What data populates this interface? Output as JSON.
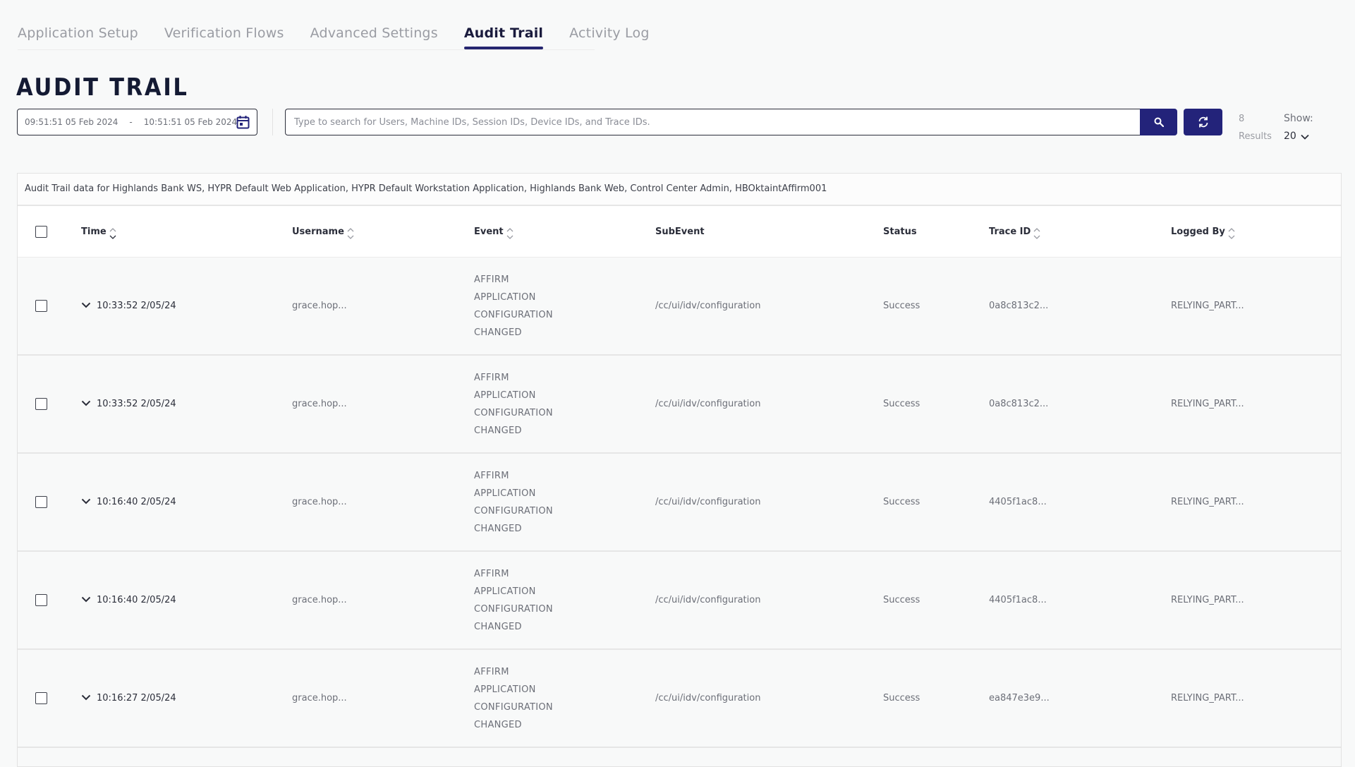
{
  "tabs": [
    {
      "label": "Application Setup",
      "active": false
    },
    {
      "label": "Verification Flows",
      "active": false
    },
    {
      "label": "Advanced Settings",
      "active": false
    },
    {
      "label": "Audit Trail",
      "active": true
    },
    {
      "label": "Activity Log",
      "active": false
    }
  ],
  "page": {
    "title": "AUDIT TRAIL"
  },
  "filters": {
    "date_start": "09:51:51 05 Feb 2024",
    "date_separator": "-",
    "date_end": "10:51:51 05 Feb 2024",
    "search_placeholder": "Type to search for Users, Machine IDs, Session IDs, Device IDs, and Trace IDs.",
    "search_value": ""
  },
  "results": {
    "count": "8",
    "label": "Results"
  },
  "show": {
    "label": "Show:",
    "value": "20"
  },
  "table": {
    "caption": "Audit Trail data for Highlands Bank WS, HYPR Default Web Application, HYPR Default Workstation Application, Highlands Bank Web, Control Center Admin, HBOktaintAffirm001",
    "columns": {
      "time": "Time",
      "username": "Username",
      "event": "Event",
      "subevent": "SubEvent",
      "status": "Status",
      "trace_id": "Trace ID",
      "logged_by": "Logged By"
    },
    "rows": [
      {
        "time": "10:33:52 2/05/24",
        "username": "grace.hop...",
        "event": [
          "AFFIRM",
          "APPLICATION",
          "CONFIGURATION",
          "CHANGED"
        ],
        "subevent": "/cc/ui/idv/configuration",
        "status": "Success",
        "trace_id": "0a8c813c2...",
        "logged_by": "RELYING_PART..."
      },
      {
        "time": "10:33:52 2/05/24",
        "username": "grace.hop...",
        "event": [
          "AFFIRM",
          "APPLICATION",
          "CONFIGURATION",
          "CHANGED"
        ],
        "subevent": "/cc/ui/idv/configuration",
        "status": "Success",
        "trace_id": "0a8c813c2...",
        "logged_by": "RELYING_PART..."
      },
      {
        "time": "10:16:40 2/05/24",
        "username": "grace.hop...",
        "event": [
          "AFFIRM",
          "APPLICATION",
          "CONFIGURATION",
          "CHANGED"
        ],
        "subevent": "/cc/ui/idv/configuration",
        "status": "Success",
        "trace_id": "4405f1ac8...",
        "logged_by": "RELYING_PART..."
      },
      {
        "time": "10:16:40 2/05/24",
        "username": "grace.hop...",
        "event": [
          "AFFIRM",
          "APPLICATION",
          "CONFIGURATION",
          "CHANGED"
        ],
        "subevent": "/cc/ui/idv/configuration",
        "status": "Success",
        "trace_id": "4405f1ac8...",
        "logged_by": "RELYING_PART..."
      },
      {
        "time": "10:16:27 2/05/24",
        "username": "grace.hop...",
        "event": [
          "AFFIRM",
          "APPLICATION",
          "CONFIGURATION",
          "CHANGED"
        ],
        "subevent": "/cc/ui/idv/configuration",
        "status": "Success",
        "trace_id": "ea847e3e9...",
        "logged_by": "RELYING_PART..."
      }
    ]
  },
  "icons": {
    "calendar": "calendar-icon",
    "search": "search-icon",
    "refresh": "refresh-icon",
    "expand": "chevron-down-icon",
    "sort": "sort-icon"
  },
  "colors": {
    "accent": "#23237a",
    "tab_active_underline": "#25256f"
  }
}
